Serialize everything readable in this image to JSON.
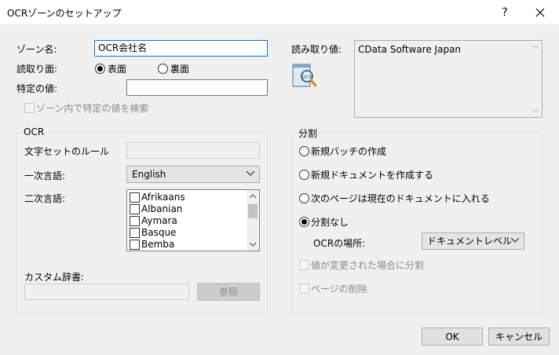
{
  "window": {
    "title": "OCRゾーンのセットアップ",
    "help_glyph": "?",
    "close_glyph": "✕"
  },
  "zone_name": {
    "label": "ゾーン名:",
    "value": "OCR会社名"
  },
  "read_side": {
    "label": "読取り面:",
    "options": [
      {
        "label": "表面",
        "checked": true
      },
      {
        "label": "裏面",
        "checked": false
      }
    ]
  },
  "specific_value": {
    "label": "特定の値:",
    "value": ""
  },
  "search_in_zone": {
    "label": "ゾーン内で特定の値を検索",
    "checked": false,
    "enabled": false
  },
  "read_value": {
    "label": "読み取り値:",
    "value": "CData Software Japan",
    "preview_icon": "ocr-preview-icon"
  },
  "ocr_group": {
    "title": "OCR",
    "charset_rule": {
      "label": "文字セットのルール",
      "value": ""
    },
    "primary_language": {
      "label": "一次言語:",
      "value": "English"
    },
    "secondary_language": {
      "label": "二次言語:",
      "items": [
        "Afrikaans",
        "Albanian",
        "Aymara",
        "Basque",
        "Bemba"
      ]
    },
    "custom_dictionary": {
      "label": "カスタム辞書:",
      "value": "",
      "browse_label": "参照"
    }
  },
  "split_group": {
    "title": "分割",
    "options": [
      {
        "label": "新規バッチの作成",
        "checked": false
      },
      {
        "label": "新規ドキュメントを作成する",
        "checked": false
      },
      {
        "label": "次のページは現在のドキュメントに入れる",
        "checked": false
      },
      {
        "label": "分割なし",
        "checked": true
      }
    ],
    "ocr_location": {
      "label": "OCRの場所:",
      "value": "ドキュメントレベル"
    },
    "split_on_change": {
      "label": "値が変更された場合に分割",
      "checked": false,
      "enabled": false
    },
    "delete_page": {
      "label": "ページの削除",
      "checked": false,
      "enabled": false
    }
  },
  "buttons": {
    "ok": "OK",
    "cancel": "キャンセル"
  }
}
